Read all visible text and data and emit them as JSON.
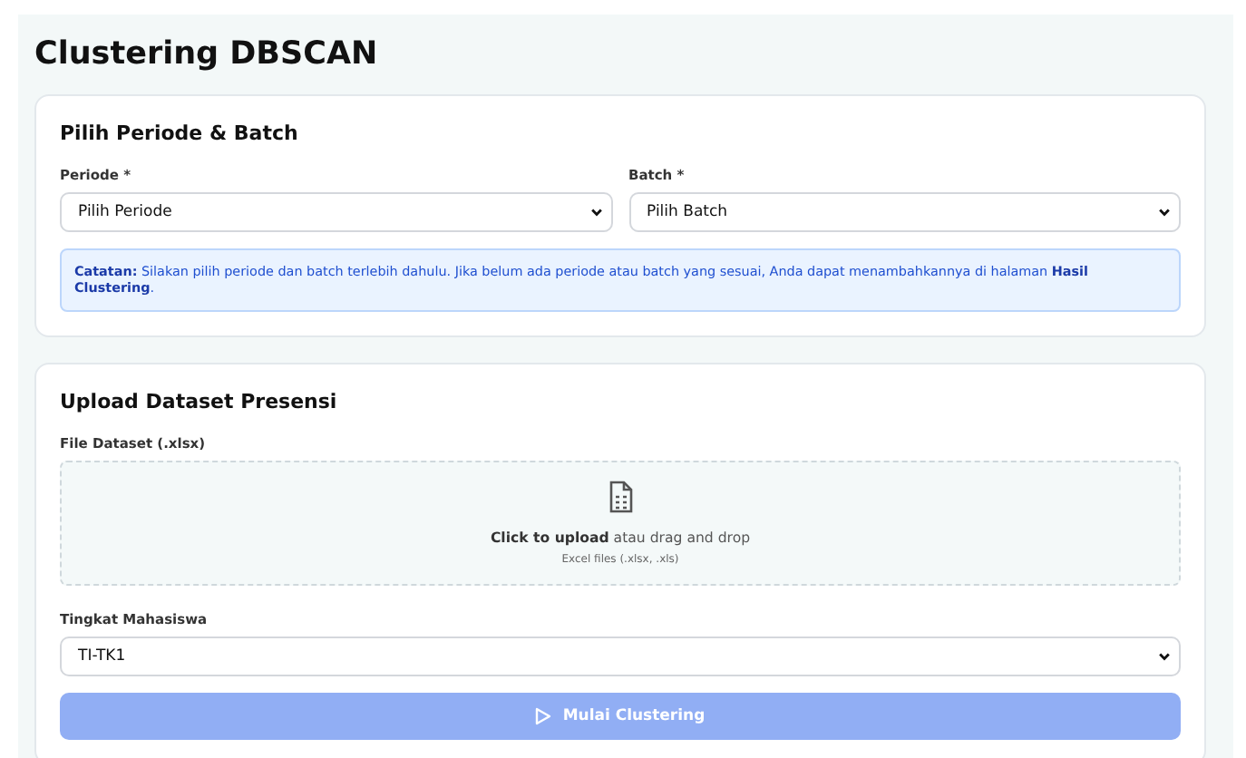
{
  "page": {
    "title": "Clustering DBSCAN"
  },
  "period_card": {
    "title": "Pilih Periode & Batch",
    "fields": [
      {
        "label": "Periode *",
        "value": "Pilih Periode"
      },
      {
        "label": "Batch *",
        "value": "Pilih Batch"
      }
    ],
    "note": "**Catatan:** Silakan pilih periode dan batch terlebih dahulu. Jika belum ada periode atau batch yang sesuai, Anda dapat menambahkannya di halaman **Hasil Clustering**."
  },
  "upload_card": {
    "title": "Upload Dataset Presensi",
    "file_label": "File Dataset (.xlsx)",
    "dropzone": {
      "prompt": "**Click to upload** atau drag and drop",
      "hint": "Excel files (.xlsx, .xls)"
    },
    "level_label": "Tingkat Mahasiswa",
    "level_value": "TI-TK1",
    "button": {
      "label": "Mulai Clustering",
      "disabled": true
    }
  }
}
